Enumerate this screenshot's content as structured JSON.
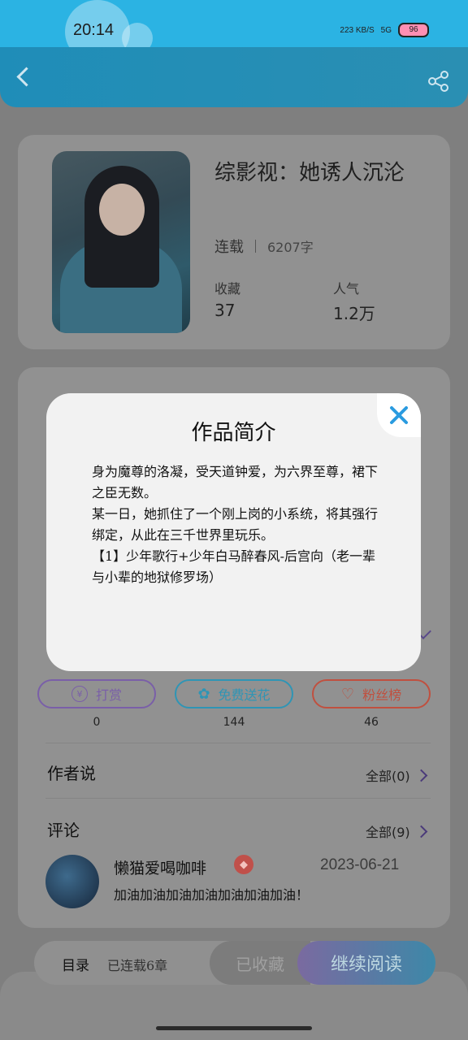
{
  "status_bar": {
    "time": "20:14",
    "speed": "223 KB/S",
    "network": "5G",
    "battery": "96"
  },
  "header": {
    "back_icon": "back-arrow-icon",
    "share_icon": "share-icon"
  },
  "book": {
    "title": "综影视：她诱人沉沦",
    "status": "连载",
    "word_count": "6207字",
    "collect_label": "收藏",
    "collect_value": "37",
    "popularity_label": "人气",
    "popularity_value": "1.2万"
  },
  "actions": [
    {
      "label": "打赏",
      "count": "0",
      "icon": "yen-icon",
      "color": "#7a5fa8"
    },
    {
      "label": "免费送花",
      "count": "144",
      "icon": "flower-icon",
      "color": "#2f95b5"
    },
    {
      "label": "粉丝榜",
      "count": "46",
      "icon": "fan-icon",
      "color": "#c0503f"
    }
  ],
  "author_says": {
    "label": "作者说",
    "all": "全部(0)"
  },
  "comments": {
    "label": "评论",
    "all": "全部(9)",
    "items": [
      {
        "user": "懒猫爱喝咖啡",
        "date": "2023-06-21",
        "text": "加油加油加油加油加油加油加油！"
      }
    ]
  },
  "bottom": {
    "catalog_label": "目录",
    "catalog_status": "已连载6章",
    "collected_label": "已收藏",
    "read_label": "继续阅读"
  },
  "modal": {
    "title": "作品简介",
    "body": "身为魔尊的洛凝，受天道钟爱，为六界至尊，裙下之臣无数。\n某一日，她抓住了一个刚上岗的小系统，将其强行绑定，从此在三千世界里玩乐。\n【1】少年歌行+少年白马醉春风-后宫向（老一辈与小辈的地狱修罗场）",
    "close_icon": "close-icon"
  },
  "colors": {
    "accent": "#2bb3e3",
    "close": "#2a9be0"
  }
}
